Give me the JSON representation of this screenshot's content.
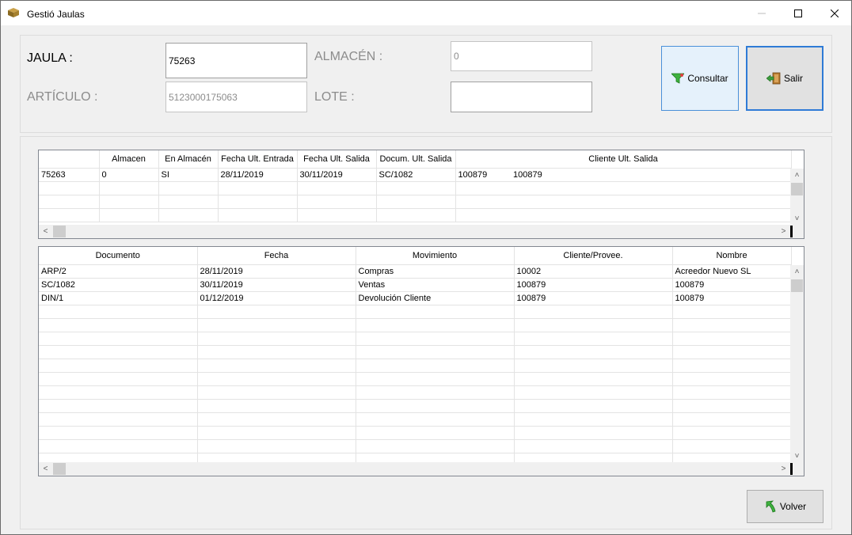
{
  "window": {
    "title": "Gestió Jaulas"
  },
  "form": {
    "jaula_label": "JAULA :",
    "jaula_value": "75263",
    "almacen_label": "ALMACÉN :",
    "almacen_value": "0",
    "articulo_label": "ARTÍCULO :",
    "articulo_value": "5123000175063",
    "lote_label": "LOTE :",
    "lote_value": ""
  },
  "buttons": {
    "consultar": "Consultar",
    "salir": "Salir",
    "volver": "Volver"
  },
  "grid1": {
    "headers": [
      "",
      "Almacen",
      "En Almacén",
      "Fecha Ult. Entrada",
      "Fecha Ult. Salida",
      "Docum. Ult. Salida",
      "Cliente Ult. Salida"
    ],
    "rows": [
      [
        "75263",
        "0",
        "SI",
        "28/11/2019",
        "30/11/2019",
        "SC/1082",
        "100879",
        "100879"
      ]
    ]
  },
  "grid2": {
    "headers": [
      "Documento",
      "Fecha",
      "Movimiento",
      "Cliente/Provee.",
      "Nombre"
    ],
    "rows": [
      [
        "ARP/2",
        "28/11/2019",
        "Compras",
        "10002",
        "Acreedor Nuevo SL"
      ],
      [
        "SC/1082",
        "30/11/2019",
        "Ventas",
        "100879",
        "100879"
      ],
      [
        "DIN/1",
        "01/12/2019",
        "Devolución Cliente",
        "100879",
        "100879"
      ]
    ]
  }
}
